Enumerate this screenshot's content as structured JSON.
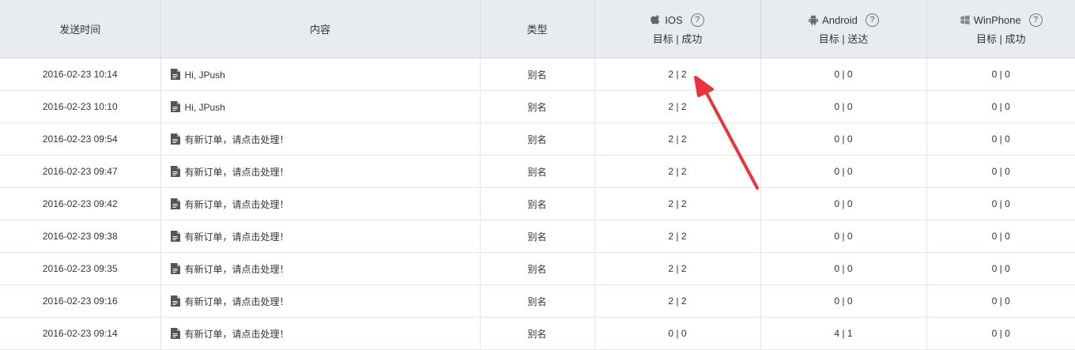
{
  "header": {
    "send_time": "发送时间",
    "content": "内容",
    "type": "类型",
    "ios": {
      "name": "IOS",
      "sub": "目标 | 成功",
      "help": "?"
    },
    "android": {
      "name": "Android",
      "sub": "目标 | 送达",
      "help": "?"
    },
    "winphone": {
      "name": "WinPhone",
      "sub": "目标 | 成功",
      "help": "?"
    }
  },
  "rows": [
    {
      "time": "2016-02-23 10:14",
      "content": "Hi, JPush",
      "type": "别名",
      "ios": "2 | 2",
      "android": "0 | 0",
      "winphone": "0 | 0"
    },
    {
      "time": "2016-02-23 10:10",
      "content": "Hi, JPush",
      "type": "别名",
      "ios": "2 | 2",
      "android": "0 | 0",
      "winphone": "0 | 0"
    },
    {
      "time": "2016-02-23 09:54",
      "content": "有新订单，请点击处理！",
      "type": "别名",
      "ios": "2 | 2",
      "android": "0 | 0",
      "winphone": "0 | 0"
    },
    {
      "time": "2016-02-23 09:47",
      "content": "有新订单，请点击处理！",
      "type": "别名",
      "ios": "2 | 2",
      "android": "0 | 0",
      "winphone": "0 | 0"
    },
    {
      "time": "2016-02-23 09:42",
      "content": "有新订单，请点击处理！",
      "type": "别名",
      "ios": "2 | 2",
      "android": "0 | 0",
      "winphone": "0 | 0"
    },
    {
      "time": "2016-02-23 09:38",
      "content": "有新订单，请点击处理！",
      "type": "别名",
      "ios": "2 | 2",
      "android": "0 | 0",
      "winphone": "0 | 0"
    },
    {
      "time": "2016-02-23 09:35",
      "content": "有新订单，请点击处理！",
      "type": "别名",
      "ios": "2 | 2",
      "android": "0 | 0",
      "winphone": "0 | 0"
    },
    {
      "time": "2016-02-23 09:16",
      "content": "有新订单，请点击处理！",
      "type": "别名",
      "ios": "2 | 2",
      "android": "0 | 0",
      "winphone": "0 | 0"
    },
    {
      "time": "2016-02-23 09:14",
      "content": "有新订单，请点击处理！",
      "type": "别名",
      "ios": "0 | 0",
      "android": "4 | 1",
      "winphone": "0 | 0"
    }
  ],
  "colors": {
    "header_bg": "#e8ecef",
    "arrow": "#e8343a"
  },
  "icons": {
    "ios": "apple-icon",
    "android": "android-icon",
    "winphone": "windows-icon",
    "content": "document-icon",
    "help": "help-circle-icon"
  }
}
